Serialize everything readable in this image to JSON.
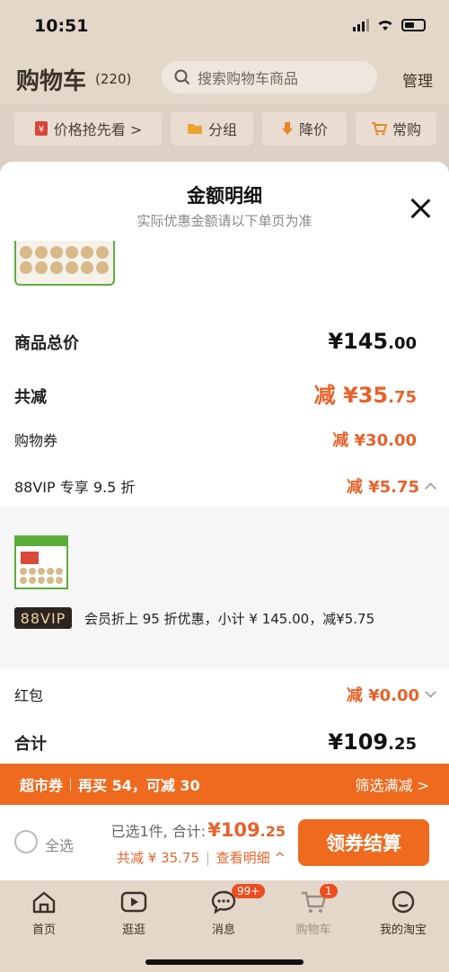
{
  "status": {
    "time": "10:51"
  },
  "header": {
    "title": "购物车",
    "count": "(220)",
    "search_placeholder": "搜索购物车商品",
    "manage": "管理"
  },
  "filters": [
    {
      "label": "价格抢先看 >"
    },
    {
      "label": "分组"
    },
    {
      "label": "降价"
    },
    {
      "label": "常购"
    }
  ],
  "modal": {
    "title": "金额明细",
    "subtitle": "实际优惠金额请以下单页为准",
    "total_label": "商品总价",
    "total_int": "¥145",
    "total_dec": ".00",
    "reduce_label": "共减",
    "reduce_int": "减 ¥35",
    "reduce_dec": ".75",
    "coupon_label": "购物券",
    "coupon_amount": "减 ¥30.00",
    "vip_label": "88VIP 专享 9.5 折",
    "vip_amount": "减 ¥5.75",
    "vip_tag": "88VIP",
    "vip_detail": "会员折上 95 折优惠，小计 ¥ 145.00，减¥5.75",
    "redpack_label": "红包",
    "redpack_amount": "减 ¥0.00",
    "sum_label": "合计",
    "sum_int": "¥109",
    "sum_dec": ".25"
  },
  "promo": {
    "tag": "超市券",
    "text": "再买 54，可减 30",
    "right": "筛选满减 >"
  },
  "checkout": {
    "select_all": "全选",
    "selected": "已选1件, 合计:",
    "price_int": "¥109",
    "price_dec": ".25",
    "saved": "共减 ¥ 35.75",
    "view_detail": "查看明细 ^",
    "button": "领券结算"
  },
  "tabs": [
    {
      "label": "首页",
      "icon": "home-icon"
    },
    {
      "label": "逛逛",
      "icon": "video-icon"
    },
    {
      "label": "消息",
      "icon": "chat-icon",
      "badge": "99+"
    },
    {
      "label": "购物车",
      "icon": "cart-icon",
      "badge": "1"
    },
    {
      "label": "我的淘宝",
      "icon": "profile-icon"
    }
  ],
  "colors": {
    "accent": "#ee6a1f",
    "price": "#e8622a",
    "vip_bg": "#2b241f"
  }
}
